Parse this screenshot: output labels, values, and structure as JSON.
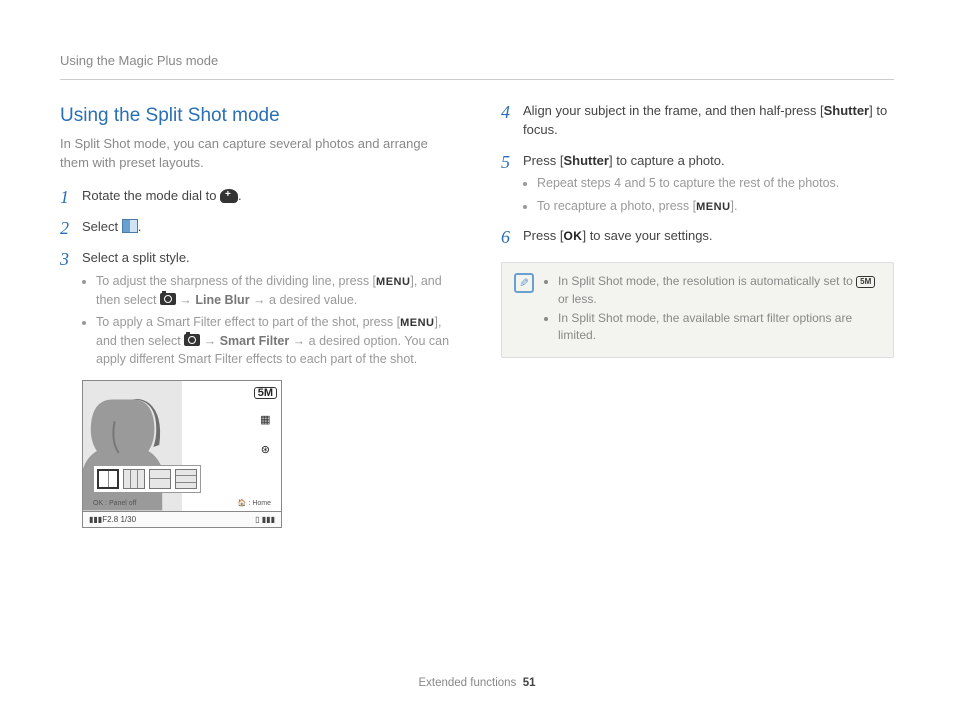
{
  "breadcrumb": "Using the Magic Plus mode",
  "title": "Using the Split Shot mode",
  "intro": "In Split Shot mode, you can capture several photos and arrange them with preset layouts.",
  "steps_left": {
    "s1_pre": "Rotate the mode dial to ",
    "s1_post": ".",
    "s2_pre": "Select ",
    "s2_post": ".",
    "s3": "Select a split style.",
    "s3_b1_pre": "To adjust the sharpness of the dividing line, press [",
    "menu_label": "MENU",
    "s3_b1_mid": "], and then select ",
    "arrow": " → ",
    "line_blur": "Line Blur",
    "s3_b1_post": " a desired value.",
    "s3_b2_pre": "To apply a Smart Filter effect to part of the shot, press [",
    "s3_b2_mid": "], and then select ",
    "smart_filter": "Smart Filter",
    "s3_b2_post": " a desired option. You can apply different Smart Filter effects to each part of the shot."
  },
  "illus": {
    "hint_ok": "OK : Panel off",
    "hint_home": "🏠 : Home",
    "bottom_left": "F2.8  1/30",
    "side_5m": "5M"
  },
  "steps_right": {
    "s4_a": "Align your subject in the frame, and then half-press [",
    "shutter": "Shutter",
    "s4_b": "] to focus.",
    "s5_a": "Press [",
    "s5_b": "] to capture a photo.",
    "s5_sub1": "Repeat steps 4 and 5 to capture the rest of the photos.",
    "s5_sub2_pre": "To recapture a photo, press [",
    "s5_sub2_post": "].",
    "s6_a": "Press [",
    "ok": "OK",
    "s6_b": "] to save your settings."
  },
  "notes": {
    "n1_pre": "In Split Shot mode, the resolution is automatically set to ",
    "n1_post": " or less.",
    "n2": "In Split Shot mode, the available smart filter options are limited."
  },
  "footer": {
    "section": "Extended functions",
    "page": "51"
  }
}
